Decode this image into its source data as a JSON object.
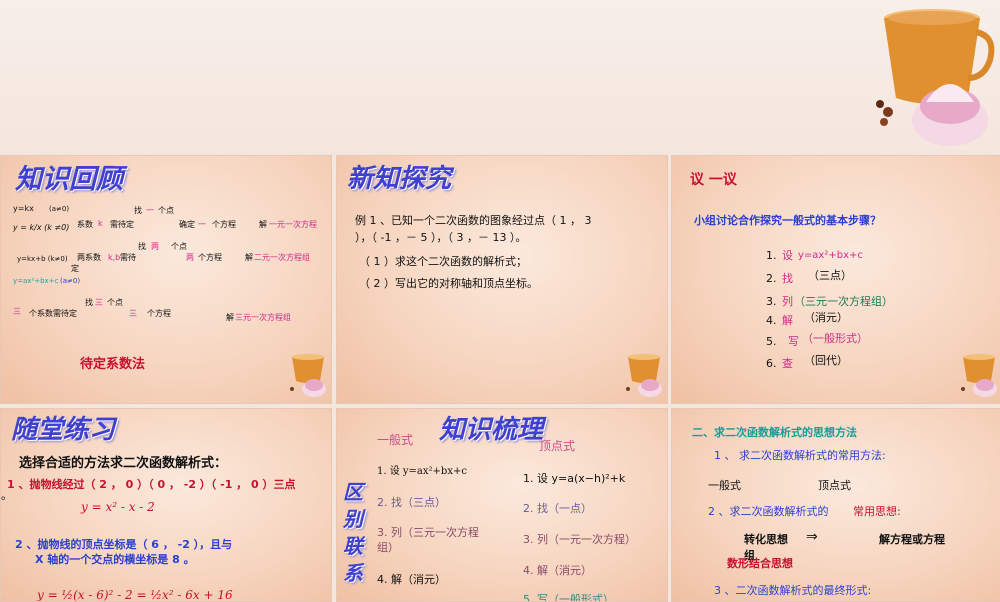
{
  "slide1": {
    "title": "知识回顾",
    "l1_a": "y=kx",
    "l1_b": "(a≠0)",
    "l1_c": "找",
    "l1_d": "一",
    "l1_e": "个点",
    "l2_a": "y = k/x (k ≠0)",
    "l2_b": "系数",
    "l2_c": "k",
    "l2_d": "需待定",
    "l2_e": "确定",
    "l2_f": "一",
    "l2_g": "个方程",
    "l2_h": "解",
    "l2_i": "一元一次方程",
    "l3_a": "找",
    "l3_b": "两",
    "l3_c": "个点",
    "l4_a": "y=kx+b (k≠0)",
    "l4_b": "两系数",
    "l4_c": "k,b",
    "l4_d": "需待",
    "l4_e": "定",
    "l4_f": "两",
    "l4_g": "个方程",
    "l4_h": "解",
    "l4_i": "二元一次方程组",
    "l5_a": "y=ax²+bx+c",
    "l5_b": "(a≠0)",
    "l6_a": "找",
    "l6_b": "三",
    "l6_c": "个点",
    "l7_a": "三",
    "l7_b": "个系数需待定",
    "l7_c": "三",
    "l7_d": "个方程",
    "l7_e": "解",
    "l7_f": "三元一次方程组",
    "method": "待定系数法"
  },
  "slide2": {
    "title": "新知探究",
    "line1": "例 1 、已知一个二次函数的图象经过点（ 1 ， 3",
    "line2": "），（ -1 ，－ 5 ），（ 3 ，－ 13 ）。",
    "line3": "（ 1 ）求这个二次函数的解析式；",
    "line4": "（ 2 ）写出它的对称轴和顶点坐标。"
  },
  "slide3": {
    "title": "议  一议",
    "subtitle": "小组讨论合作探究一般式的基本步骤？",
    "s1_n": "1.",
    "s1_a": "设",
    "s1_b": "y=ax²+bx+c",
    "s2_n": "2.",
    "s2_a": "找",
    "s2_b": "（三点）",
    "s3_n": "3.",
    "s3_a": "列",
    "s3_b": "（三元一次方程组）",
    "s4_n": "4.",
    "s4_a": "解",
    "s4_b": "（消元）",
    "s5_n": "5.",
    "s5_a": "写",
    "s5_b": "（一般形式）",
    "s6_n": "6.",
    "s6_a": "查",
    "s6_b": "（回代）"
  },
  "slide4": {
    "title": "随堂练习",
    "heading": "选择合适的方法求二次函数解析式：",
    "p1": "1 、抛物线经过（ 2 ， 0 ）（ 0 ， -2 ）（ -1 ， 0 ）三点",
    "p1_tail": "。",
    "eq1": "y = x² - x - 2",
    "p2a": "2 、抛物线的顶点坐标是（ 6 ， -2 ），且与",
    "p2b": "X 轴的一个交点的横坐标是 8 。",
    "eq2": "y = ½(x - 6)² - 2 = ½x² - 6x + 16"
  },
  "slide5": {
    "title": "知识梳理",
    "left_head": "一般式",
    "right_head": "顶点式",
    "vertical": "区别联系",
    "l1": "1. 设 y=ax²+bx+c",
    "l2": "2. 找（三点）",
    "l3a": "3. 列（三元一次方程",
    "l3b": "组）",
    "l4": "4. 解（消元）",
    "r1": "1. 设 y=a(x−h)²+k",
    "r2": "2. 找（一点）",
    "r3": "3. 列（一元一次方程）",
    "r4": "4. 解（消元）",
    "r5": "5. 写（一般形式）"
  },
  "slide6": {
    "heading": "二、求二次函数解析式的思想方法",
    "h1": "1 、    求二次函数解析式的常用方法:",
    "m1": "一般式",
    "m2": "顶点式",
    "h2a": "2 、求二次函数解析式的",
    "h2b": "常用思想:",
    "idea1": "转化思想",
    "arrow": "⇒",
    "idea2": "解方程或方程",
    "idea3": "组",
    "idea4": "数形结合思想",
    "h3": "3 、二次函数解析式的最终形式:"
  }
}
